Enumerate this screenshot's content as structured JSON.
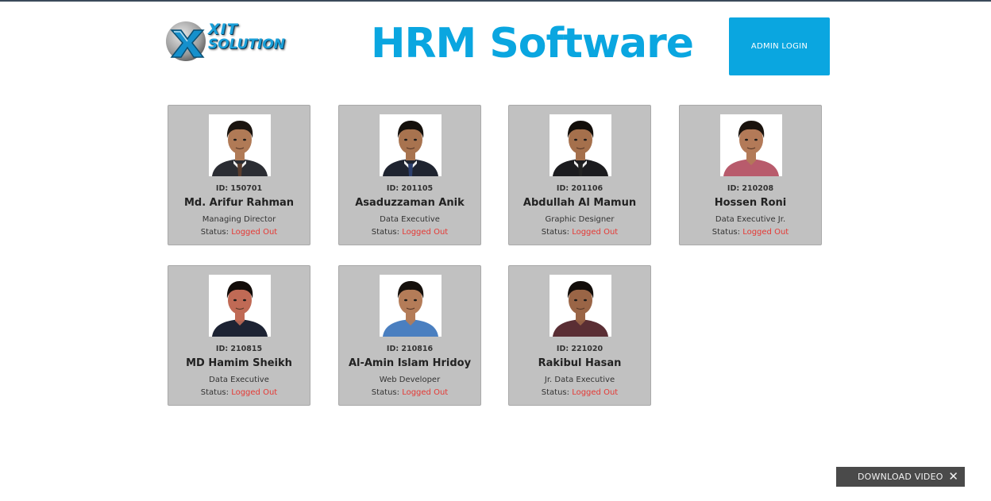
{
  "header": {
    "logo_line1": "XIT",
    "logo_line2": "SOLUTION",
    "title": "HRM Software",
    "admin_login_label": "ADMIN LOGIN"
  },
  "employees": [
    {
      "id_label": "ID: 150701",
      "name": "Md. Arifur Rahman",
      "role": "Managing Director",
      "status_label": "Status:",
      "status_value": "Logged Out",
      "shirt": "#2b2d33",
      "skin": "#b07a56",
      "hair": "#1b1510",
      "tie": "#5a3d2e"
    },
    {
      "id_label": "ID: 201105",
      "name": "Asaduzzaman Anik",
      "role": "Data Executive",
      "status_label": "Status:",
      "status_value": "Logged Out",
      "shirt": "#1f2430",
      "skin": "#a8734f",
      "hair": "#14100c",
      "tie": "#2c3e6b"
    },
    {
      "id_label": "ID: 201106",
      "name": "Abdullah Al Mamun",
      "role": "Graphic Designer",
      "status_label": "Status:",
      "status_value": "Logged Out",
      "shirt": "#1c1c1f",
      "skin": "#a5704c",
      "hair": "#120e0a",
      "tie": "#222222"
    },
    {
      "id_label": "ID: 210208",
      "name": "Hossen Roni",
      "role": "Data Executive Jr.",
      "status_label": "Status:",
      "status_value": "Logged Out",
      "shirt": "#b85b6c",
      "skin": "#b37a58",
      "hair": "#1a130e",
      "tie": ""
    },
    {
      "id_label": "ID: 210815",
      "name": "MD Hamim Sheikh",
      "role": "Data Executive",
      "status_label": "Status:",
      "status_value": "Logged Out",
      "shirt": "#1d2333",
      "skin": "#c06a55",
      "hair": "#120c09",
      "tie": ""
    },
    {
      "id_label": "ID: 210816",
      "name": "Al-Amin Islam Hridoy",
      "role": "Web Developer",
      "status_label": "Status:",
      "status_value": "Logged Out",
      "shirt": "#4a7fc0",
      "skin": "#b47c58",
      "hair": "#15100c",
      "tie": ""
    },
    {
      "id_label": "ID: 221020",
      "name": "Rakibul Hasan",
      "role": "Jr. Data Executive",
      "status_label": "Status:",
      "status_value": "Logged Out",
      "shirt": "#5a2e34",
      "skin": "#9a6546",
      "hair": "#120d0a",
      "tie": ""
    }
  ],
  "download_bar": {
    "label": "DOWNLOAD VIDEO",
    "close_glyph": "✕"
  },
  "colors": {
    "accent": "#0aa6e0",
    "card_bg": "#c1c1c1",
    "status_logged_out": "#e53935"
  }
}
